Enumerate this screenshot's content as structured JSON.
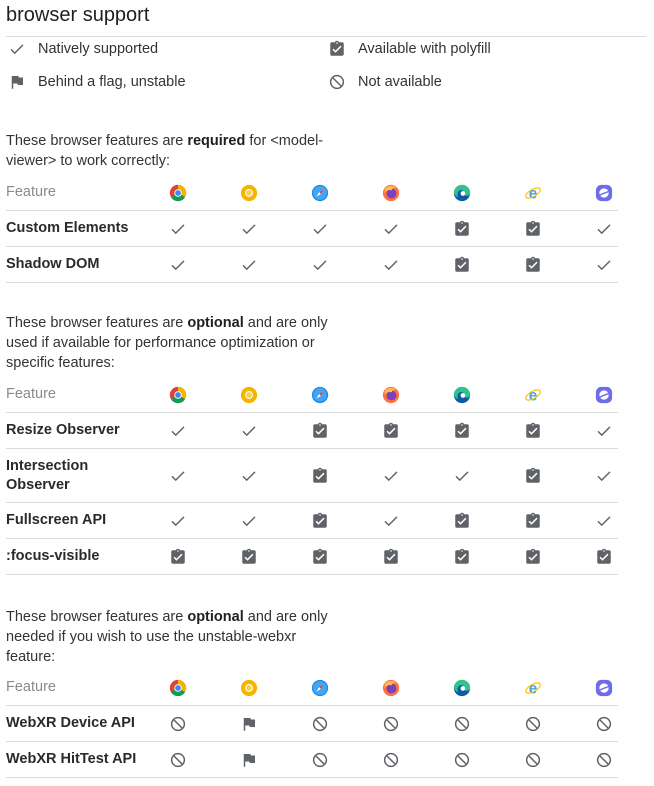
{
  "title": "browser support",
  "legend": [
    {
      "icon": "check-icon",
      "label": "Natively supported"
    },
    {
      "icon": "clipboard-check-icon",
      "label": "Available with polyfill"
    },
    {
      "icon": "flag-icon",
      "label": "Behind a flag, unstable"
    },
    {
      "icon": "not-available-icon",
      "label": "Not available"
    }
  ],
  "browsers": [
    {
      "name": "Chrome",
      "icon": "chrome-icon"
    },
    {
      "name": "Canary",
      "icon": "chrome-canary-icon"
    },
    {
      "name": "Safari",
      "icon": "safari-icon"
    },
    {
      "name": "Firefox",
      "icon": "firefox-icon"
    },
    {
      "name": "Edge",
      "icon": "edge-icon"
    },
    {
      "name": "IE11",
      "icon": "ie-icon"
    },
    {
      "name": "Samsung Internet",
      "icon": "samsung-internet-icon"
    }
  ],
  "sections": [
    {
      "intro_pre": "These browser features are ",
      "intro_bold": "required",
      "intro_post": " for <model-viewer> to work correctly:",
      "header": "Feature",
      "rows": [
        {
          "feature": "Custom Elements",
          "support": [
            "native",
            "native",
            "native",
            "native",
            "polyfill",
            "polyfill",
            "native"
          ]
        },
        {
          "feature": "Shadow DOM",
          "support": [
            "native",
            "native",
            "native",
            "native",
            "polyfill",
            "polyfill",
            "native"
          ]
        }
      ]
    },
    {
      "intro_pre": "These browser features are ",
      "intro_bold": "optional",
      "intro_post": " and are only used if available for performance optimization or specific features:",
      "header": "Feature",
      "rows": [
        {
          "feature": "Resize Observer",
          "support": [
            "native",
            "native",
            "polyfill",
            "polyfill",
            "polyfill",
            "polyfill",
            "native"
          ]
        },
        {
          "feature": "Intersection Observer",
          "support": [
            "native",
            "native",
            "polyfill",
            "native",
            "native",
            "polyfill",
            "native"
          ]
        },
        {
          "feature": "Fullscreen API",
          "support": [
            "native",
            "native",
            "polyfill",
            "native",
            "polyfill",
            "polyfill",
            "native"
          ]
        },
        {
          "feature": ":focus-visible",
          "support": [
            "polyfill",
            "polyfill",
            "polyfill",
            "polyfill",
            "polyfill",
            "polyfill",
            "polyfill"
          ]
        }
      ]
    },
    {
      "intro_pre": "These browser features are ",
      "intro_bold": "optional",
      "intro_post": " and are only needed if you wish to use the unstable-webxr feature:",
      "header": "Feature",
      "rows": [
        {
          "feature": "WebXR Device API",
          "support": [
            "none",
            "flag",
            "none",
            "none",
            "none",
            "none",
            "none"
          ]
        },
        {
          "feature": "WebXR HitTest API",
          "support": [
            "none",
            "flag",
            "none",
            "none",
            "none",
            "none",
            "none"
          ]
        }
      ]
    }
  ]
}
